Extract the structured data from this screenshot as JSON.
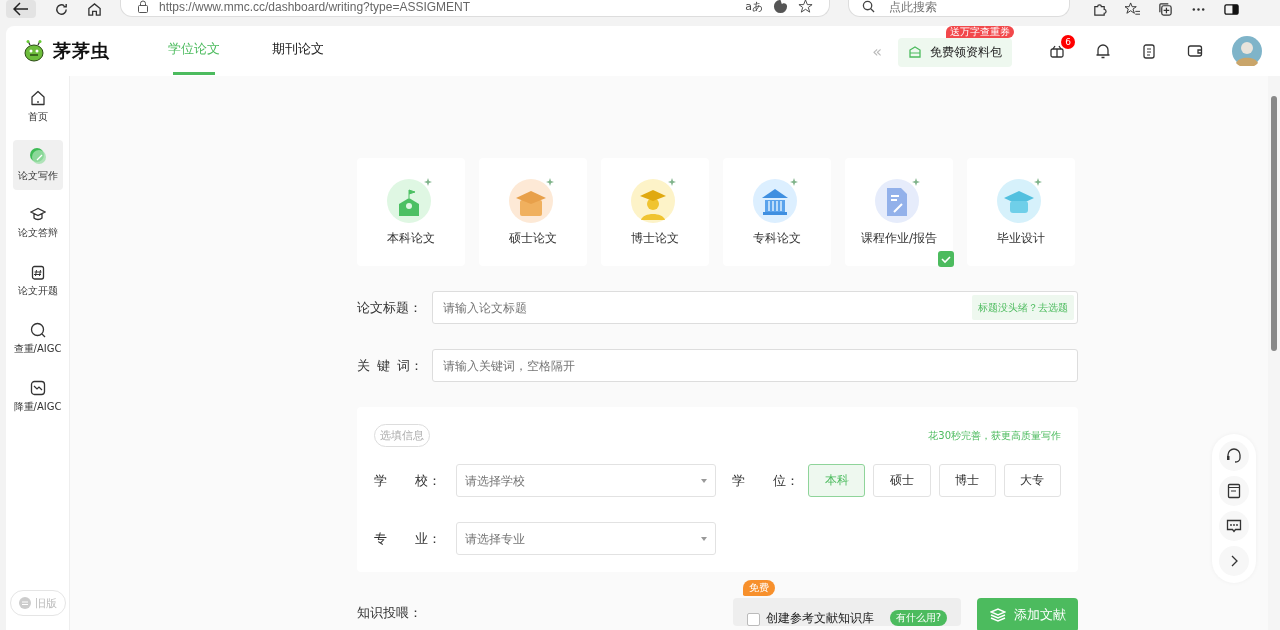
{
  "browser": {
    "url": "https://www.mmc.cc/dashboard/writing?type=ASSIGMENT",
    "translate_glyph": "aあ",
    "search_placeholder": "点此搜索"
  },
  "header": {
    "logo_text": "茅茅虫",
    "tabs": [
      {
        "label": "学位论文",
        "selected": true
      },
      {
        "label": "期刊论文",
        "selected": false
      }
    ],
    "collapse_glyph": "«",
    "promo_button": "免费领资料包",
    "promo_badge": "送万字查重券",
    "gift_count": "6"
  },
  "sidebar": {
    "items": [
      {
        "label": "首页",
        "kind": "home",
        "selected": false
      },
      {
        "label": "论文写作",
        "kind": "pen",
        "selected": true
      },
      {
        "label": "论文答辩",
        "kind": "cap",
        "selected": false
      },
      {
        "label": "论文开题",
        "kind": "hash",
        "selected": false
      },
      {
        "label": "查重/AIGC",
        "kind": "search",
        "selected": false
      },
      {
        "label": "降重/AIGC",
        "kind": "trend",
        "selected": false
      }
    ],
    "old_version": "旧版"
  },
  "paper_types": [
    {
      "label": "本科论文",
      "kind": "school",
      "selected": false
    },
    {
      "label": "硕士论文",
      "kind": "box",
      "selected": false
    },
    {
      "label": "博士论文",
      "kind": "doctor",
      "selected": false
    },
    {
      "label": "专科论文",
      "kind": "bank",
      "selected": false
    },
    {
      "label": "课程作业/报告",
      "kind": "doc",
      "selected": true
    },
    {
      "label": "毕业设计",
      "kind": "grad",
      "selected": false
    }
  ],
  "title_field": {
    "label": "论文标题：",
    "placeholder": "请输入论文标题",
    "hint_button": "标题没头绪？去选题"
  },
  "keywords_field": {
    "label": "关 键 词：",
    "placeholder": "请输入关键词，空格隔开"
  },
  "optional": {
    "tag": "选填信息",
    "tip": "花30秒完善，获更高质量写作",
    "school": {
      "label": "学 校：",
      "placeholder": "请选择学校"
    },
    "degree": {
      "label": "学 位：",
      "options": [
        {
          "label": "本科",
          "selected": true
        },
        {
          "label": "硕士",
          "selected": false
        },
        {
          "label": "博士",
          "selected": false
        },
        {
          "label": "大专",
          "selected": false
        }
      ]
    },
    "major": {
      "label": "专 业：",
      "placeholder": "请选择专业"
    }
  },
  "knowledge": {
    "label": "知识投喂：",
    "free_badge": "免费",
    "checkbox": {
      "label": "创建参考文献知识库",
      "checked": false
    },
    "help_pill": "有什么用?",
    "add_button": "添加文献"
  }
}
